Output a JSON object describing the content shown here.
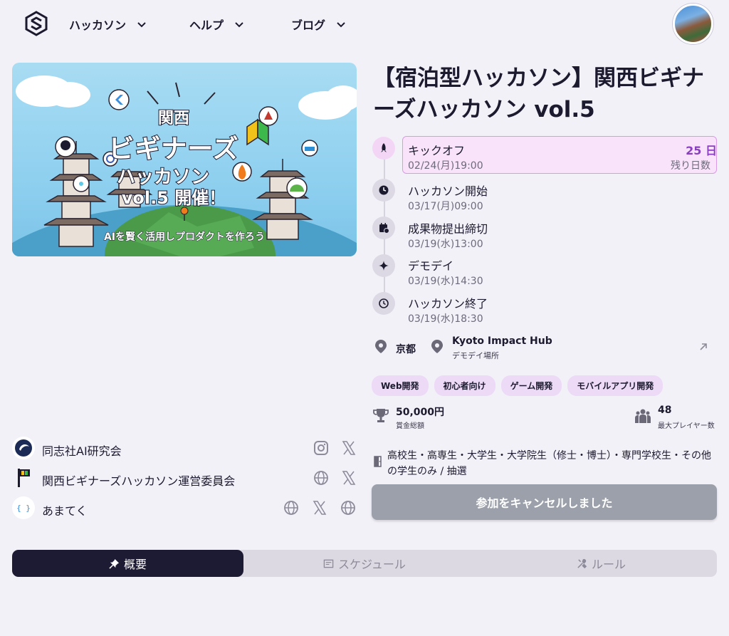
{
  "header": {
    "logo_icon": "brand-logo-icon",
    "nav": [
      {
        "label": "ハッカソン",
        "icon": "chevron-down-icon"
      },
      {
        "label": "ヘルプ",
        "icon": "chevron-down-icon"
      },
      {
        "label": "ブログ",
        "icon": "chevron-down-icon"
      }
    ],
    "avatar_icon": "user-avatar"
  },
  "hero": {
    "line1": "関西",
    "line2": "ビギナーズ",
    "line3": "ハッカソン",
    "line4": "vol.5 開催！",
    "subtitle": "AIを賢く活用しプロダクトを作ろう"
  },
  "event": {
    "title": "【宿泊型ハッカソン】関西ビギナーズハッカソン vol.5"
  },
  "timeline": [
    {
      "label": "キックオフ",
      "date": "02/24(月)19:00",
      "icon": "rocket-icon",
      "active": true
    },
    {
      "label": "ハッカソン開始",
      "date": "03/17(月)09:00",
      "icon": "clock-icon"
    },
    {
      "label": "成果物提出締切",
      "date": "03/19(水)13:00",
      "icon": "calendar-clock-icon"
    },
    {
      "label": "デモデイ",
      "date": "03/19(水)14:30",
      "icon": "sparkle-icon"
    },
    {
      "label": "ハッカソン終了",
      "date": "03/19(水)18:30",
      "icon": "clock-outline-icon"
    }
  ],
  "countdown": {
    "value": "25 日",
    "label": "残り日数"
  },
  "location": {
    "city": "京都",
    "venue": "Kyoto Impact Hub",
    "venue_note": "デモデイ場所"
  },
  "tags": [
    "Web開発",
    "初心者向け",
    "ゲーム開発",
    "モバイルアプリ開発"
  ],
  "stats": {
    "prize_value": "50,000円",
    "prize_label": "賞金総額",
    "players_value": "48",
    "players_label": "最大プレイヤー数"
  },
  "eligibility": "高校生・高専生・大学生・大学院生（修士・博士）・専門学校生・その他の学生のみ / 抽選",
  "cancel_button": "参加をキャンセルしました",
  "organizers": [
    {
      "name": "同志社AI研究会",
      "links": [
        "instagram-icon",
        "x-icon"
      ]
    },
    {
      "name": "関西ビギナーズハッカソン運営委員会",
      "links": [
        "globe-icon",
        "x-icon"
      ]
    },
    {
      "name": "あまてく",
      "links": [
        "globe-icon",
        "x-icon",
        "globe-icon"
      ]
    }
  ],
  "tabs": [
    {
      "label": "概要",
      "icon": "pin-icon",
      "active": true
    },
    {
      "label": "スケジュール",
      "icon": "schedule-icon"
    },
    {
      "label": "ルール",
      "icon": "tools-icon"
    }
  ],
  "colors": {
    "background": "#f3f1f8",
    "accent_purple": "#8a3ec2",
    "tag_bg": "#ecdaf7",
    "active_tab": "#1d1a33",
    "button_disabled": "#9ba0aa"
  }
}
